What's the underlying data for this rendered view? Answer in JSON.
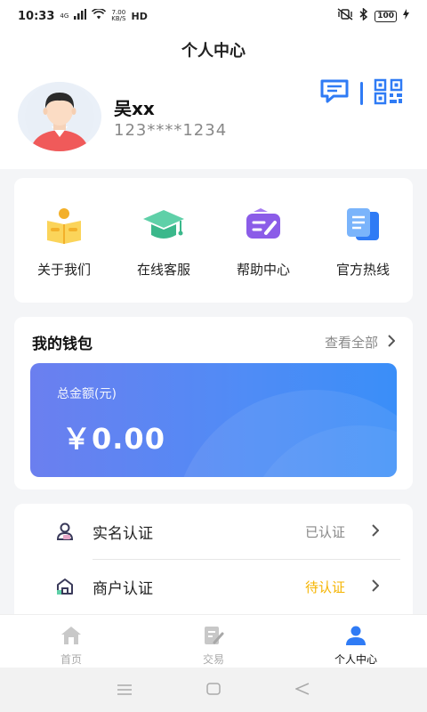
{
  "status_bar": {
    "time": "10:33",
    "network": "4G",
    "speed_value": "7.00",
    "speed_unit": "KB/S",
    "hd": "HD",
    "battery": "100"
  },
  "header": {
    "title": "个人中心"
  },
  "profile": {
    "name": "吴xx",
    "phone": "123****1234",
    "icons": [
      "message-icon",
      "qrcode-icon"
    ]
  },
  "shortcuts": [
    {
      "label": "关于我们",
      "icon": "book-icon"
    },
    {
      "label": "在线客服",
      "icon": "graduation-cap-icon"
    },
    {
      "label": "帮助中心",
      "icon": "help-ticket-icon"
    },
    {
      "label": "官方热线",
      "icon": "document-icon"
    }
  ],
  "wallet": {
    "title": "我的钱包",
    "view_all": "查看全部",
    "balance_label": "总金额(元)",
    "balance_amount": "￥0.00"
  },
  "certifications": [
    {
      "label": "实名认证",
      "status": "已认证",
      "status_color": "#888888",
      "icon": "person-icon"
    },
    {
      "label": "商户认证",
      "status": "待认证",
      "status_color": "#f5b400",
      "icon": "shop-icon"
    }
  ],
  "tabbar": [
    {
      "label": "首页",
      "icon": "home-icon",
      "active": false
    },
    {
      "label": "交易",
      "icon": "edit-note-icon",
      "active": false
    },
    {
      "label": "个人中心",
      "icon": "user-icon",
      "active": true
    }
  ],
  "colors": {
    "accent": "#2f7bf5",
    "pending": "#f5b400"
  }
}
